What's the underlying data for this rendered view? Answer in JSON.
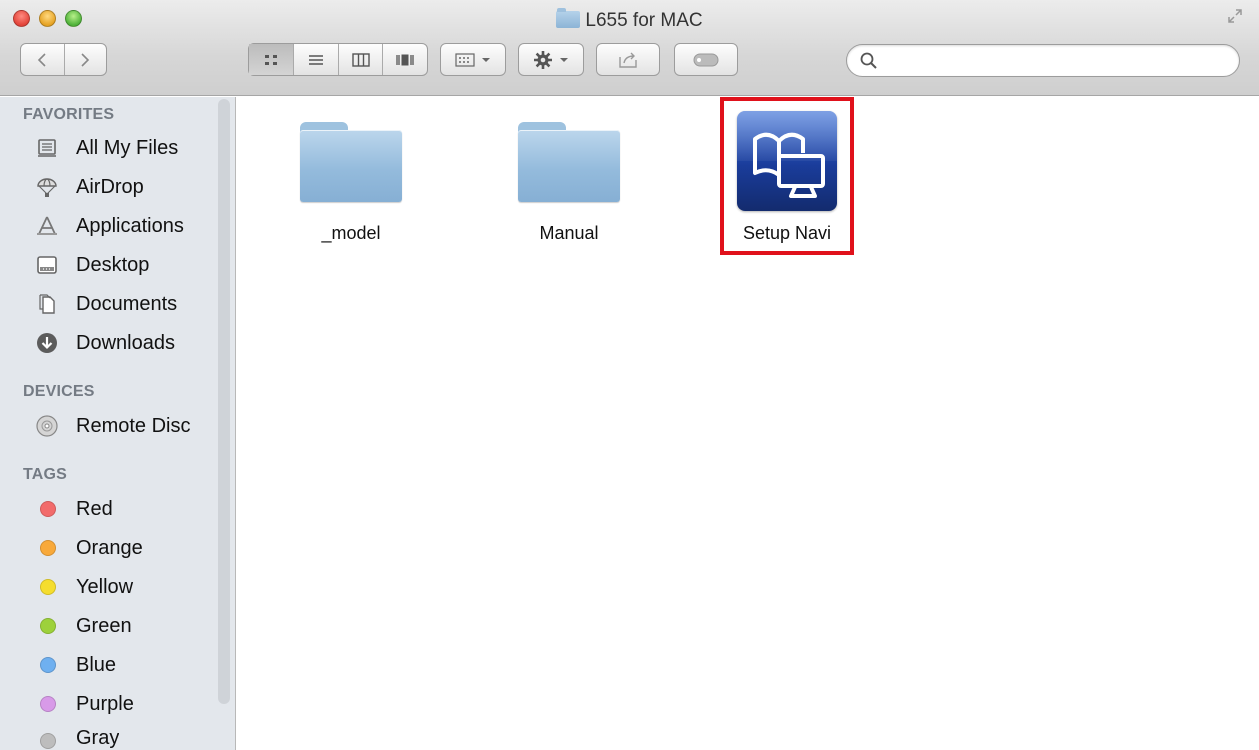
{
  "window": {
    "title": "L655 for MAC"
  },
  "toolbar": {
    "nav": [
      "back",
      "forward"
    ],
    "view_modes": [
      "icon-view",
      "list-view",
      "column-view",
      "cover-flow-view"
    ],
    "active_view": "icon-view",
    "search": {
      "value": "",
      "placeholder": ""
    }
  },
  "sidebar": {
    "sections": [
      {
        "heading": "FAVORITES",
        "items": [
          {
            "label": "All My Files",
            "icon": "all-files-icon"
          },
          {
            "label": "AirDrop",
            "icon": "airdrop-icon"
          },
          {
            "label": "Applications",
            "icon": "applications-icon"
          },
          {
            "label": "Desktop",
            "icon": "desktop-icon"
          },
          {
            "label": "Documents",
            "icon": "documents-icon"
          },
          {
            "label": "Downloads",
            "icon": "downloads-icon"
          }
        ]
      },
      {
        "heading": "DEVICES",
        "items": [
          {
            "label": "Remote Disc",
            "icon": "disc-icon"
          }
        ]
      },
      {
        "heading": "TAGS",
        "items": [
          {
            "label": "Red",
            "color": "#f26b6b"
          },
          {
            "label": "Orange",
            "color": "#f8a93a"
          },
          {
            "label": "Yellow",
            "color": "#f5dd2e"
          },
          {
            "label": "Green",
            "color": "#9dd13b"
          },
          {
            "label": "Blue",
            "color": "#6fb0f0"
          },
          {
            "label": "Purple",
            "color": "#d89ae8"
          },
          {
            "label": "Gray",
            "color": "#bdbdbd"
          }
        ]
      }
    ]
  },
  "files": [
    {
      "name": "_model",
      "kind": "folder"
    },
    {
      "name": "Manual",
      "kind": "folder"
    },
    {
      "name": "Setup Navi",
      "kind": "application",
      "highlighted": true
    }
  ],
  "colors": {
    "highlight": "#e0111b",
    "sidebar_bg": "#e3e7ec",
    "folder": "#94bbdc",
    "app_icon": "#1a3c9a"
  }
}
